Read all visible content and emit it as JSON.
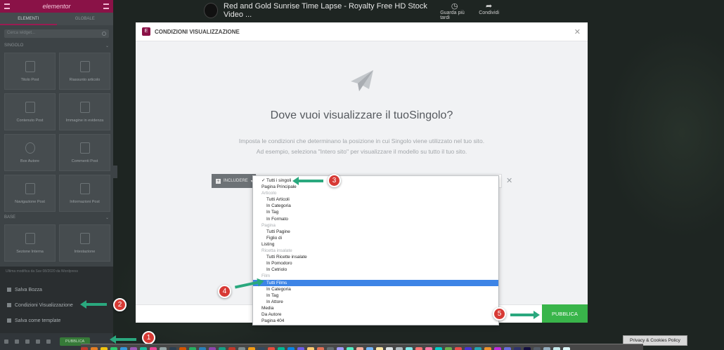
{
  "panel": {
    "brand": "elementor",
    "tabs": [
      "ELEMENTI",
      "GLOBALE"
    ],
    "search_placeholder": "Cerca widget...",
    "section_singolo": "SINGOLO",
    "section_base": "BASE",
    "widgets": [
      "Titolo Post",
      "Riassunto articolo",
      "Contenuto Post",
      "Immagine in evidenza",
      "Box Autore",
      "Commenti Post",
      "Navigazione Post",
      "Informazioni Post",
      "Sezione Interna",
      "Intestazione"
    ],
    "hint": "Ultima modifica da Sav 08/2020 da Wordpress",
    "menu": [
      "Salva Bozza",
      "Condizioni Visualizzazione",
      "Salva come template"
    ],
    "publish": "PUBBLICA"
  },
  "video": {
    "title": "Red and Gold Sunrise Time Lapse - Royalty Free HD Stock Video ...",
    "watch_later": "Guarda più tardi",
    "share": "Condividi"
  },
  "modal": {
    "title": "CONDIZIONI VISUALIZZAZIONE",
    "heading": "Dove vuoi visualizzare il tuoSingolo?",
    "desc_line1": "Imposta le condizioni che determinano la posizione in cui Singolo viene utilizzato nel tuo sito.",
    "desc_line2": "Ad esempio, seleziona \"Intero sito\" per visualizzare il modello su tutto il tuo sito.",
    "include": "INCLUDERE",
    "publish": "PUBBLICA"
  },
  "dropdown": [
    {
      "label": "✓ Tutti i singoli",
      "kind": "top"
    },
    {
      "label": "Pagina Principale",
      "kind": "top"
    },
    {
      "label": "Articolo",
      "kind": "group"
    },
    {
      "label": "Tutti Articoli",
      "kind": "sub"
    },
    {
      "label": "In Categoria",
      "kind": "sub"
    },
    {
      "label": "In Tag",
      "kind": "sub"
    },
    {
      "label": "In Formato",
      "kind": "sub"
    },
    {
      "label": "Pagina",
      "kind": "group"
    },
    {
      "label": "Tutti Pagine",
      "kind": "sub"
    },
    {
      "label": "Figlio di",
      "kind": "sub"
    },
    {
      "label": "Listing",
      "kind": "top"
    },
    {
      "label": "Ricetta insalate",
      "kind": "group"
    },
    {
      "label": "Tutti Ricette insalate",
      "kind": "sub"
    },
    {
      "label": "In Pomodoro",
      "kind": "sub"
    },
    {
      "label": "In Cetriolo",
      "kind": "sub"
    },
    {
      "label": "Film",
      "kind": "group"
    },
    {
      "label": "Tutti Films",
      "kind": "sub",
      "selected": true
    },
    {
      "label": "In Categoria",
      "kind": "sub"
    },
    {
      "label": "In Tag",
      "kind": "sub"
    },
    {
      "label": "In Attore",
      "kind": "sub"
    },
    {
      "label": "Media",
      "kind": "top"
    },
    {
      "label": "Da Autore",
      "kind": "top"
    },
    {
      "label": "Pagina 404",
      "kind": "top"
    }
  ],
  "markers": [
    "1",
    "2",
    "3",
    "4",
    "5"
  ],
  "privacy": "Privacy & Cookies Policy",
  "colors": {
    "brand": "#8a1247",
    "publish": "#39b54a",
    "selected": "#3d84e6",
    "arrow": "#2aa87e",
    "badge": "#d73a35"
  }
}
